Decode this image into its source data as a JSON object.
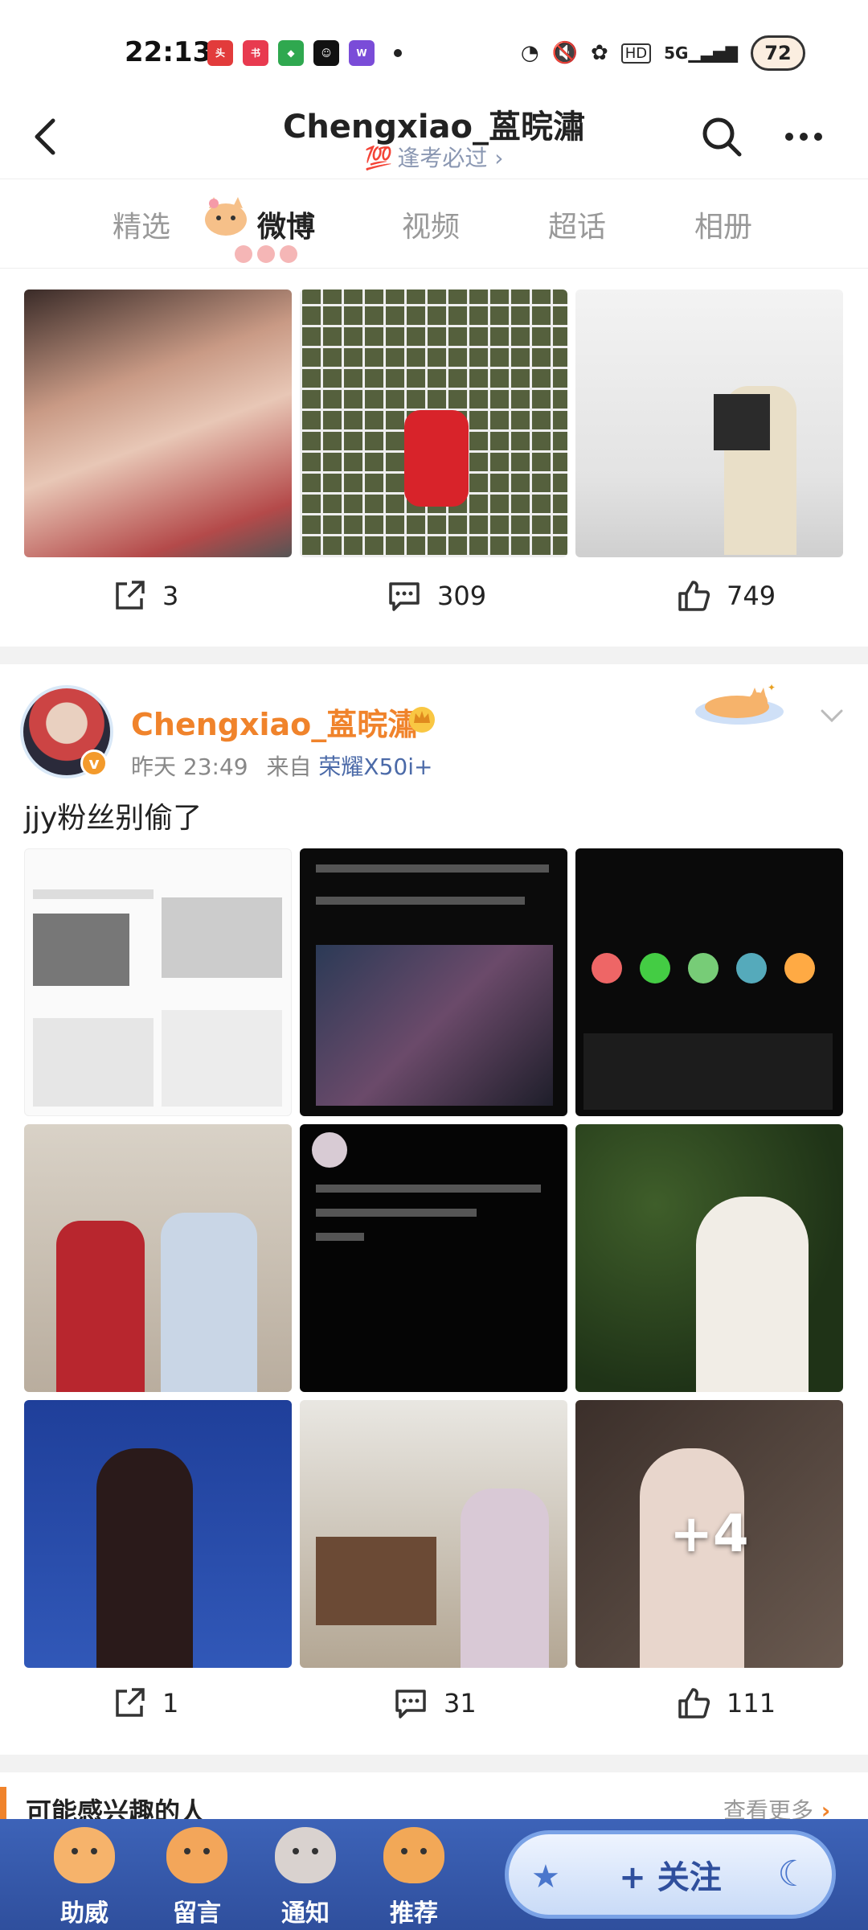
{
  "status_bar": {
    "time": "22:13",
    "app_icons": [
      "头条",
      "小红书",
      "shield",
      "face",
      "WEE"
    ],
    "battery": "72",
    "signal": "5G"
  },
  "header": {
    "title": "Chengxiao_蒕晥潚",
    "subtitle": "逢考必过",
    "subtitle_icon": "100-icon"
  },
  "tabs": [
    {
      "label": "精选",
      "active": false
    },
    {
      "label": "微博",
      "active": true
    },
    {
      "label": "视频",
      "active": false
    },
    {
      "label": "超话",
      "active": false
    },
    {
      "label": "相册",
      "active": false
    }
  ],
  "post1": {
    "actions": {
      "repost": "3",
      "comment": "309",
      "like": "749"
    }
  },
  "post2": {
    "author": "Chengxiao_蒕晥潚",
    "time": "昨天 23:49",
    "from_label": "来自",
    "device": "荣耀X50i+",
    "text": "jjy粉丝别偷了",
    "more_count": "+4",
    "actions": {
      "repost": "1",
      "comment": "31",
      "like": "111"
    }
  },
  "suggestions": {
    "title": "可能感兴趣的人",
    "more": "查看更多"
  },
  "bottom_nav": [
    {
      "label": "助威"
    },
    {
      "label": "留言"
    },
    {
      "label": "通知"
    },
    {
      "label": "推荐"
    }
  ],
  "follow_button": "+ 关注",
  "colors": {
    "accent_orange": "#f0832b",
    "link_blue": "#4b6aa8",
    "bottom_bar_blue": "#3d63b8"
  }
}
